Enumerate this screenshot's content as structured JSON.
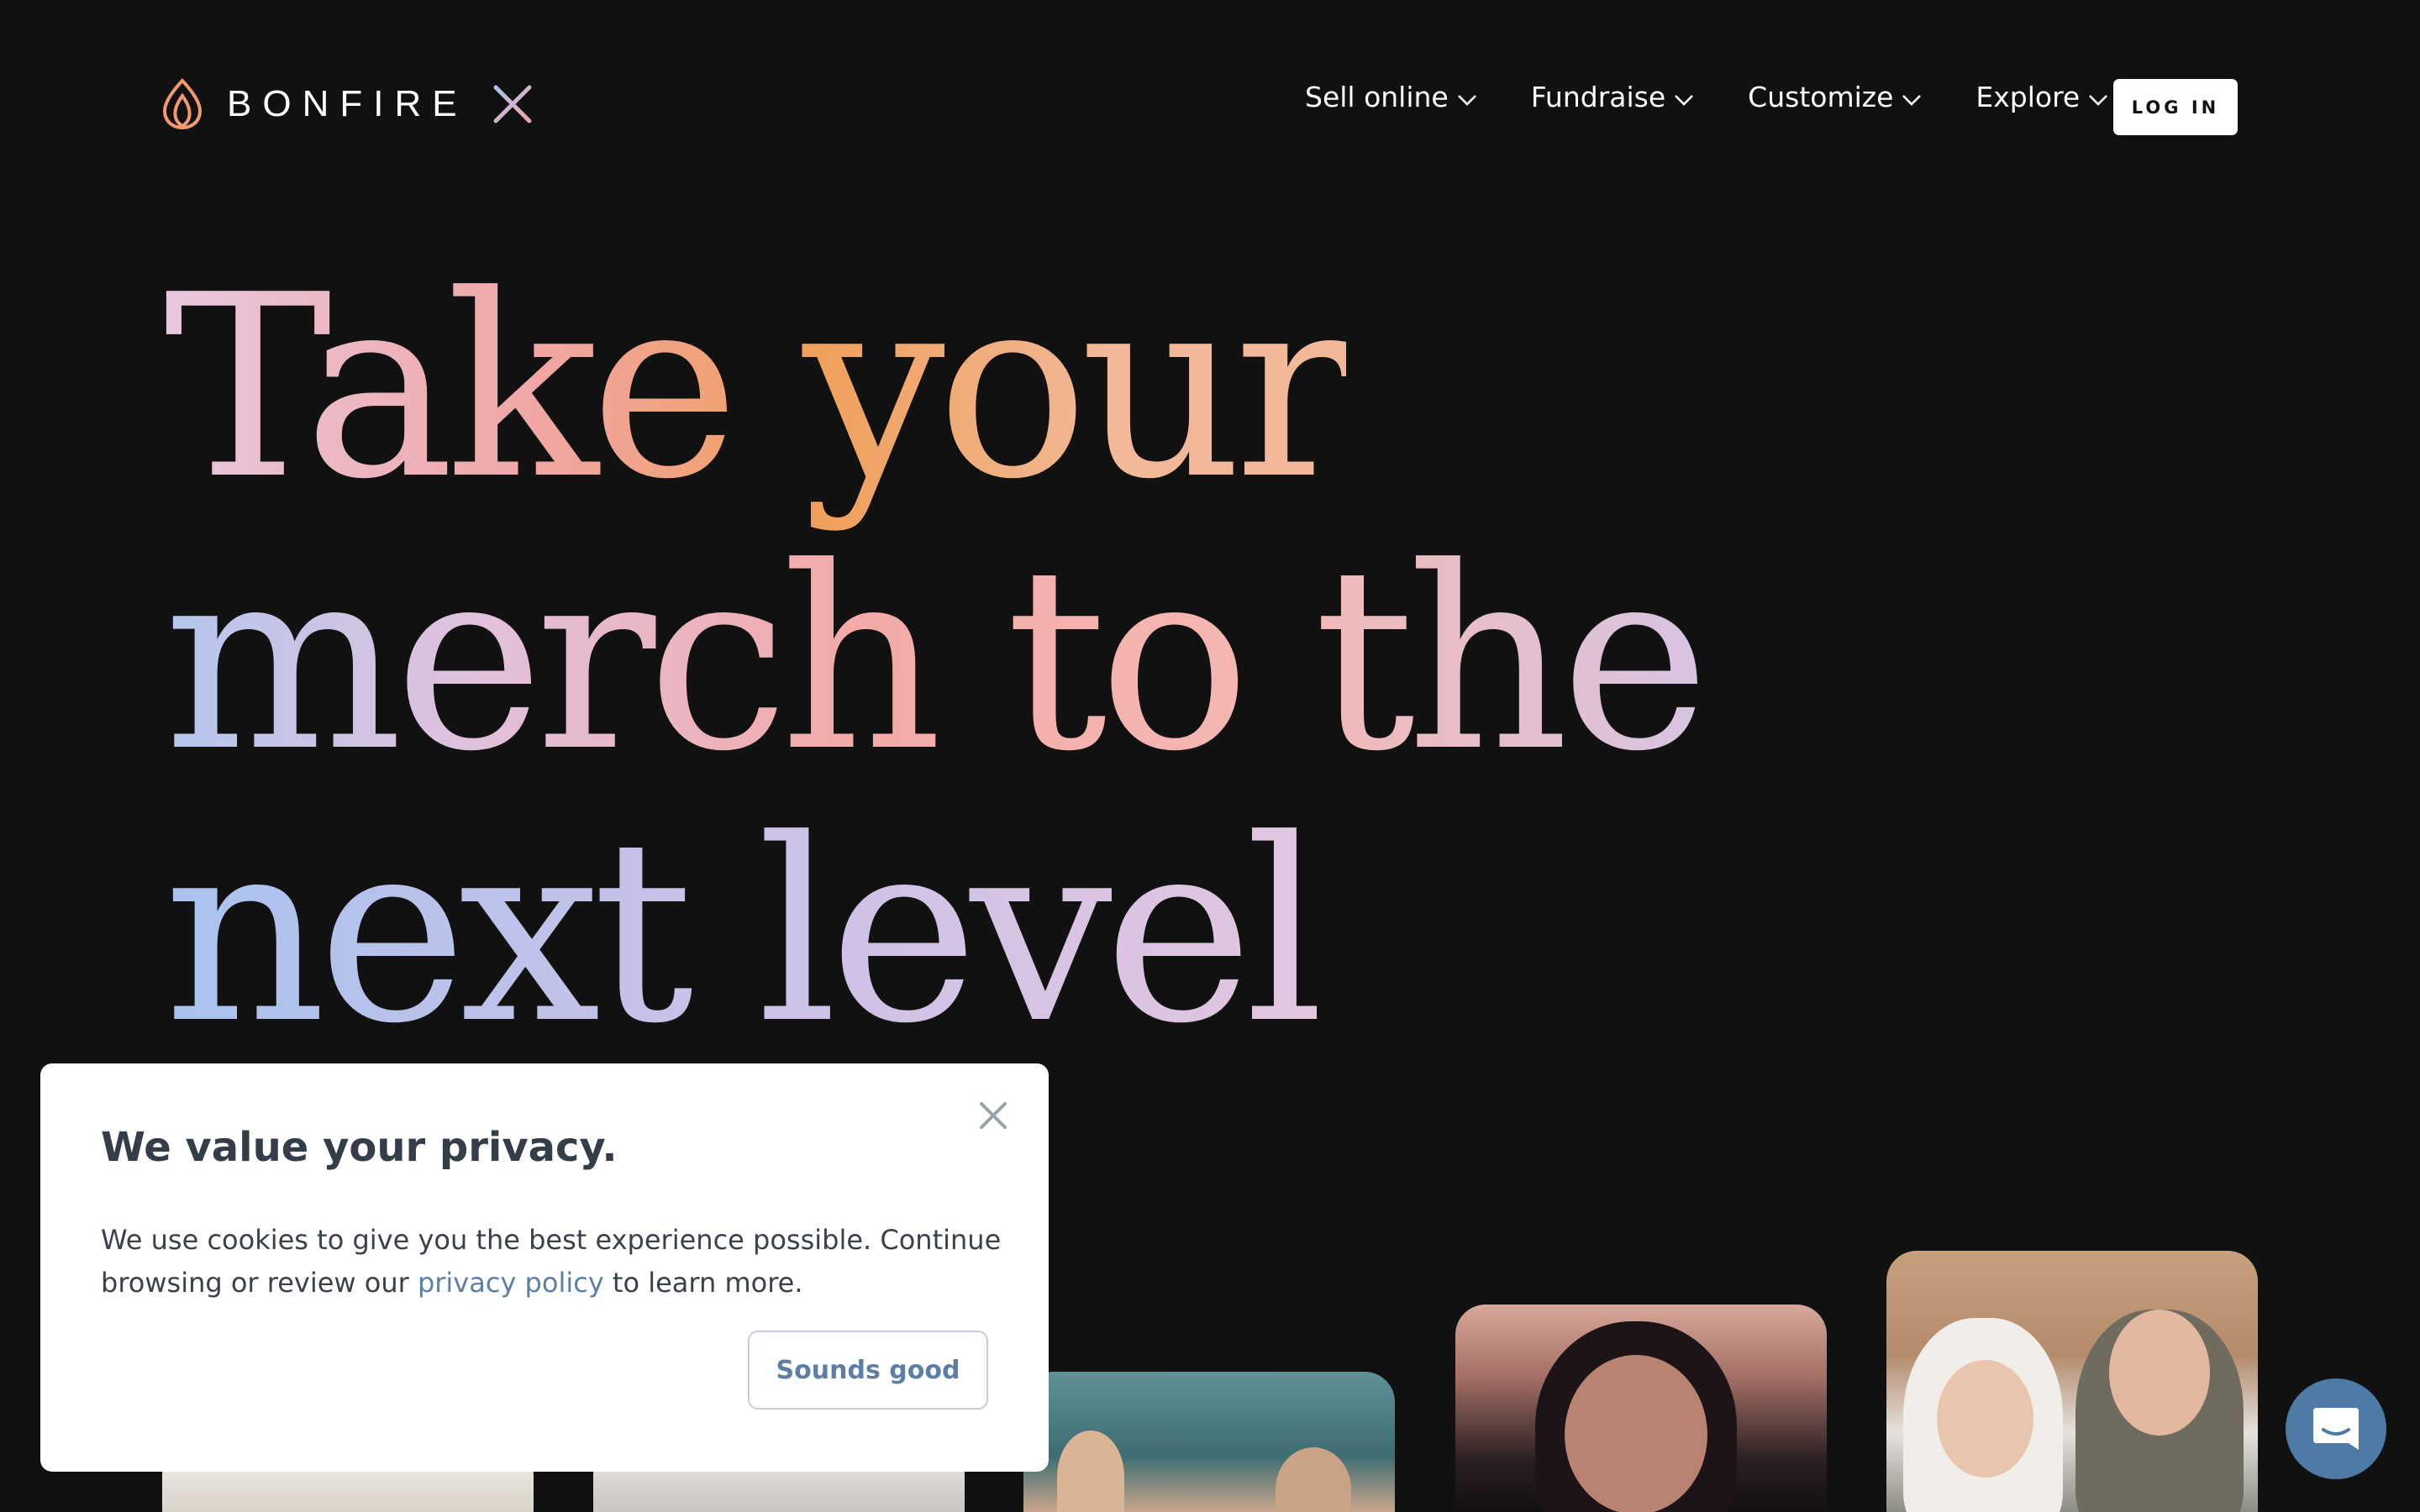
{
  "header": {
    "brand": "BONFIRE",
    "nav": [
      {
        "label": "Sell online"
      },
      {
        "label": "Fundraise"
      },
      {
        "label": "Customize"
      },
      {
        "label": "Explore"
      }
    ],
    "login_label": "LOG IN"
  },
  "hero": {
    "line1": "Take your",
    "line2": "merch to the",
    "line3": "next level"
  },
  "cookie": {
    "title": "We value your privacy.",
    "text_before": "We use cookies to give you the best experience possible. Continue browsing or review our ",
    "link": "privacy policy",
    "text_after": " to learn more.",
    "button": "Sounds good"
  },
  "icons": {
    "logo": "flame-leaf-icon",
    "logo_x": "x-mark-icon",
    "dropdown": "chevron-down-icon",
    "close": "close-icon",
    "chat": "chat-icon"
  },
  "colors": {
    "background": "#111111",
    "logo_flame": "#f29a6e",
    "logo_x_start": "#a9c3ee",
    "logo_x_end": "#f0a3a9",
    "link": "#5d7fa3",
    "chat_button": "#4e7ba5",
    "hero_peach": "#f0a05a",
    "hero_pink": "#e8c8df",
    "hero_blue": "#a9c3ee"
  }
}
